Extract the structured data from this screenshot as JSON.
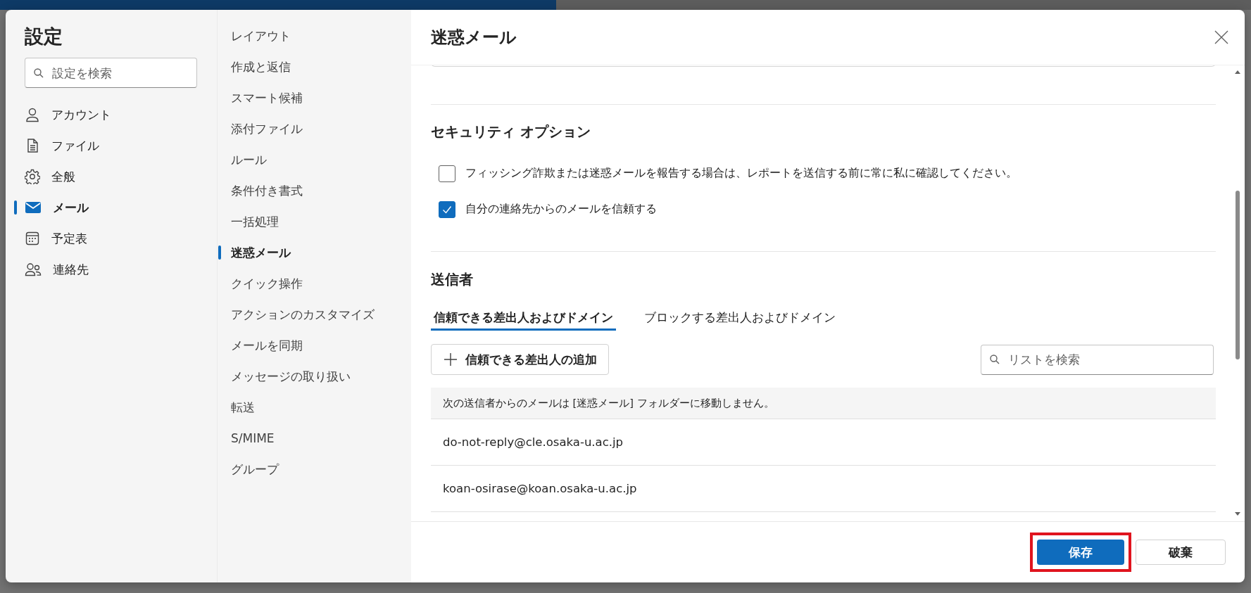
{
  "settings": {
    "title": "設定",
    "search": {
      "placeholder": "設定を検索"
    },
    "categories": [
      {
        "label": "アカウント",
        "selected": false
      },
      {
        "label": "ファイル",
        "selected": false
      },
      {
        "label": "全般",
        "selected": false
      },
      {
        "label": "メール",
        "selected": true
      },
      {
        "label": "予定表",
        "selected": false
      },
      {
        "label": "連絡先",
        "selected": false
      }
    ]
  },
  "subnav": [
    {
      "label": "レイアウト",
      "selected": false
    },
    {
      "label": "作成と返信",
      "selected": false
    },
    {
      "label": "スマート候補",
      "selected": false
    },
    {
      "label": "添付ファイル",
      "selected": false
    },
    {
      "label": "ルール",
      "selected": false
    },
    {
      "label": "条件付き書式",
      "selected": false
    },
    {
      "label": "一括処理",
      "selected": false
    },
    {
      "label": "迷惑メール",
      "selected": true
    },
    {
      "label": "クイック操作",
      "selected": false
    },
    {
      "label": "アクションのカスタマイズ",
      "selected": false
    },
    {
      "label": "メールを同期",
      "selected": false
    },
    {
      "label": "メッセージの取り扱い",
      "selected": false
    },
    {
      "label": "転送",
      "selected": false
    },
    {
      "label": "S/MIME",
      "selected": false
    },
    {
      "label": "グループ",
      "selected": false
    }
  ],
  "panel": {
    "title": "迷惑メール",
    "security": {
      "heading": "セキュリティ オプション",
      "options": [
        {
          "label": "フィッシング詐欺または迷惑メールを報告する場合は、レポートを送信する前に常に私に確認してください。",
          "checked": false
        },
        {
          "label": "自分の連絡先からのメールを信頼する",
          "checked": true
        }
      ]
    },
    "senders": {
      "heading": "送信者",
      "tabs": [
        {
          "label": "信頼できる差出人およびドメイン",
          "selected": true
        },
        {
          "label": "ブロックする差出人およびドメイン",
          "selected": false
        }
      ],
      "add_button": "信頼できる差出人の追加",
      "search": {
        "placeholder": "リストを検索"
      },
      "list_header": "次の送信者からのメールは [迷惑メール] フォルダーに移動しません。",
      "rows": [
        "do-not-reply@cle.osaka-u.ac.jp",
        "koan-osirase@koan.osaka-u.ac.jp"
      ]
    },
    "buttons": [
      {
        "label": "保存",
        "kind": "primary",
        "highlighted": true
      },
      {
        "label": "破棄",
        "kind": "secondary",
        "highlighted": false
      }
    ]
  }
}
